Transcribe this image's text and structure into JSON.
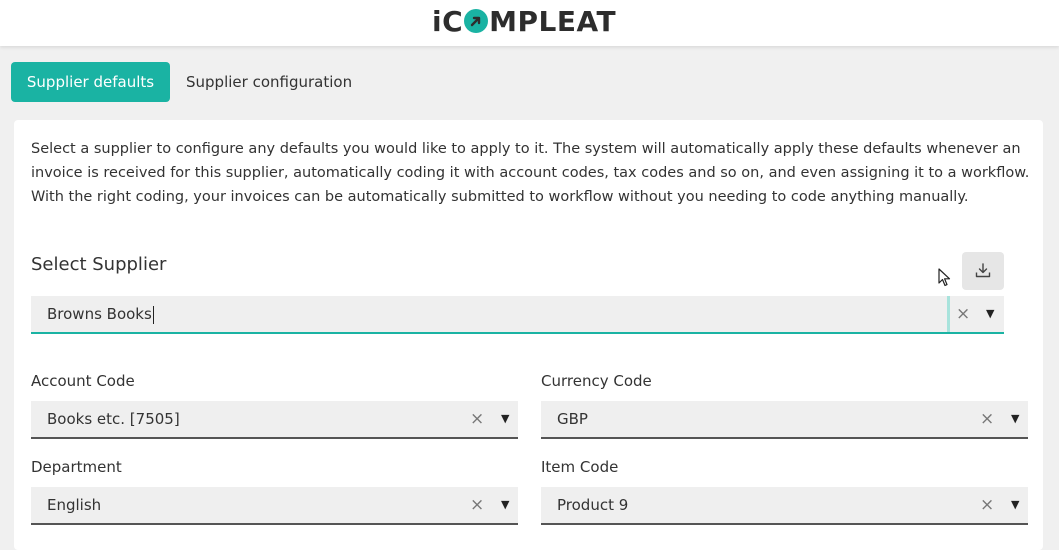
{
  "header": {
    "logo_text_pre": "iC",
    "logo_text_post": "MPLEAT"
  },
  "tabs": {
    "active_label": "Supplier defaults",
    "inactive_label": "Supplier configuration"
  },
  "description": "Select a supplier to configure any defaults you would like to apply to it. The system will automatically apply these defaults whenever an invoice is received for this supplier, automatically coding it with account codes, tax codes and so on, and even assigning it to a workflow. With the right coding, your invoices can be automatically submitted to workflow without you needing to code anything manually.",
  "supplier": {
    "title": "Select Supplier",
    "value": "Browns Books",
    "clear": "×",
    "arrow": "▼"
  },
  "fields": {
    "account_code": {
      "label": "Account Code",
      "value": "Books etc. [7505]"
    },
    "currency_code": {
      "label": "Currency Code",
      "value": "GBP"
    },
    "department": {
      "label": "Department",
      "value": "English"
    },
    "item_code": {
      "label": "Item Code",
      "value": "Product 9"
    },
    "clear_glyph": "×",
    "arrow_glyph": "▼"
  },
  "colors": {
    "accent": "#1ab3a3",
    "background": "#f0f0f0"
  },
  "icons": {
    "export": "download-tray-icon",
    "cursor": "mouse-pointer-icon"
  }
}
